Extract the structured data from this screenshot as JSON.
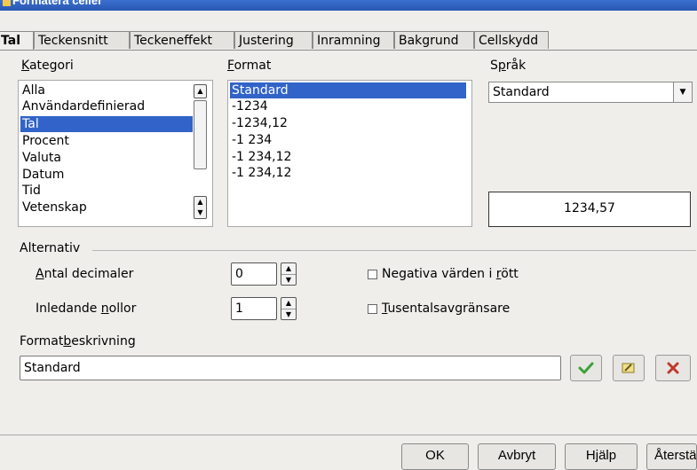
{
  "window": {
    "title": "Formatera celler"
  },
  "tabs": [
    "Tal",
    "Teckensnitt",
    "Teckeneffekt",
    "Justering",
    "Inramning",
    "Bakgrund",
    "Cellskydd"
  ],
  "kategori": {
    "label_u": "K",
    "label_rest": "ategori",
    "items": [
      "Alla",
      "Användardefinierad",
      "Tal",
      "Procent",
      "Valuta",
      "Datum",
      "Tid",
      "Vetenskap"
    ],
    "selected": "Tal"
  },
  "format": {
    "label_u": "F",
    "label_rest": "ormat",
    "items": [
      "Standard",
      "-1234",
      "-1234,12",
      "-1 234",
      "-1 234,12",
      "-1 234,12"
    ],
    "selected": "Standard"
  },
  "sprak": {
    "label_pre": "S",
    "label_u": "p",
    "label_rest": "råk",
    "value": "Standard"
  },
  "preview": {
    "value": "1234,57"
  },
  "alternativ": {
    "heading": "Alternativ",
    "decimals": {
      "label_u": "A",
      "label_rest": "ntal decimaler",
      "value": "0"
    },
    "leading": {
      "label_pre": "Inledande ",
      "label_u": "n",
      "label_rest": "ollor",
      "value": "1"
    },
    "negative_red": {
      "label_pre": "Negativa värden i ",
      "label_u": "r",
      "label_rest": "ött",
      "checked": false
    },
    "thousands": {
      "label_u": "T",
      "label_rest": "usentalsavgränsare",
      "checked": false
    }
  },
  "beskrivning": {
    "label_pre": "Format",
    "label_u": "b",
    "label_rest": "eskrivning",
    "value": "Standard"
  },
  "icons": {
    "accept": "checkmark-icon",
    "edit": "edit-comment-icon",
    "delete": "delete-x-icon"
  },
  "colors": {
    "selection": "#3163c8",
    "accept": "#3aa23a",
    "delete": "#c0392b"
  },
  "buttons": {
    "ok": "OK",
    "cancel": "Avbryt",
    "help": "Hjälp",
    "reset": "Återställ"
  }
}
